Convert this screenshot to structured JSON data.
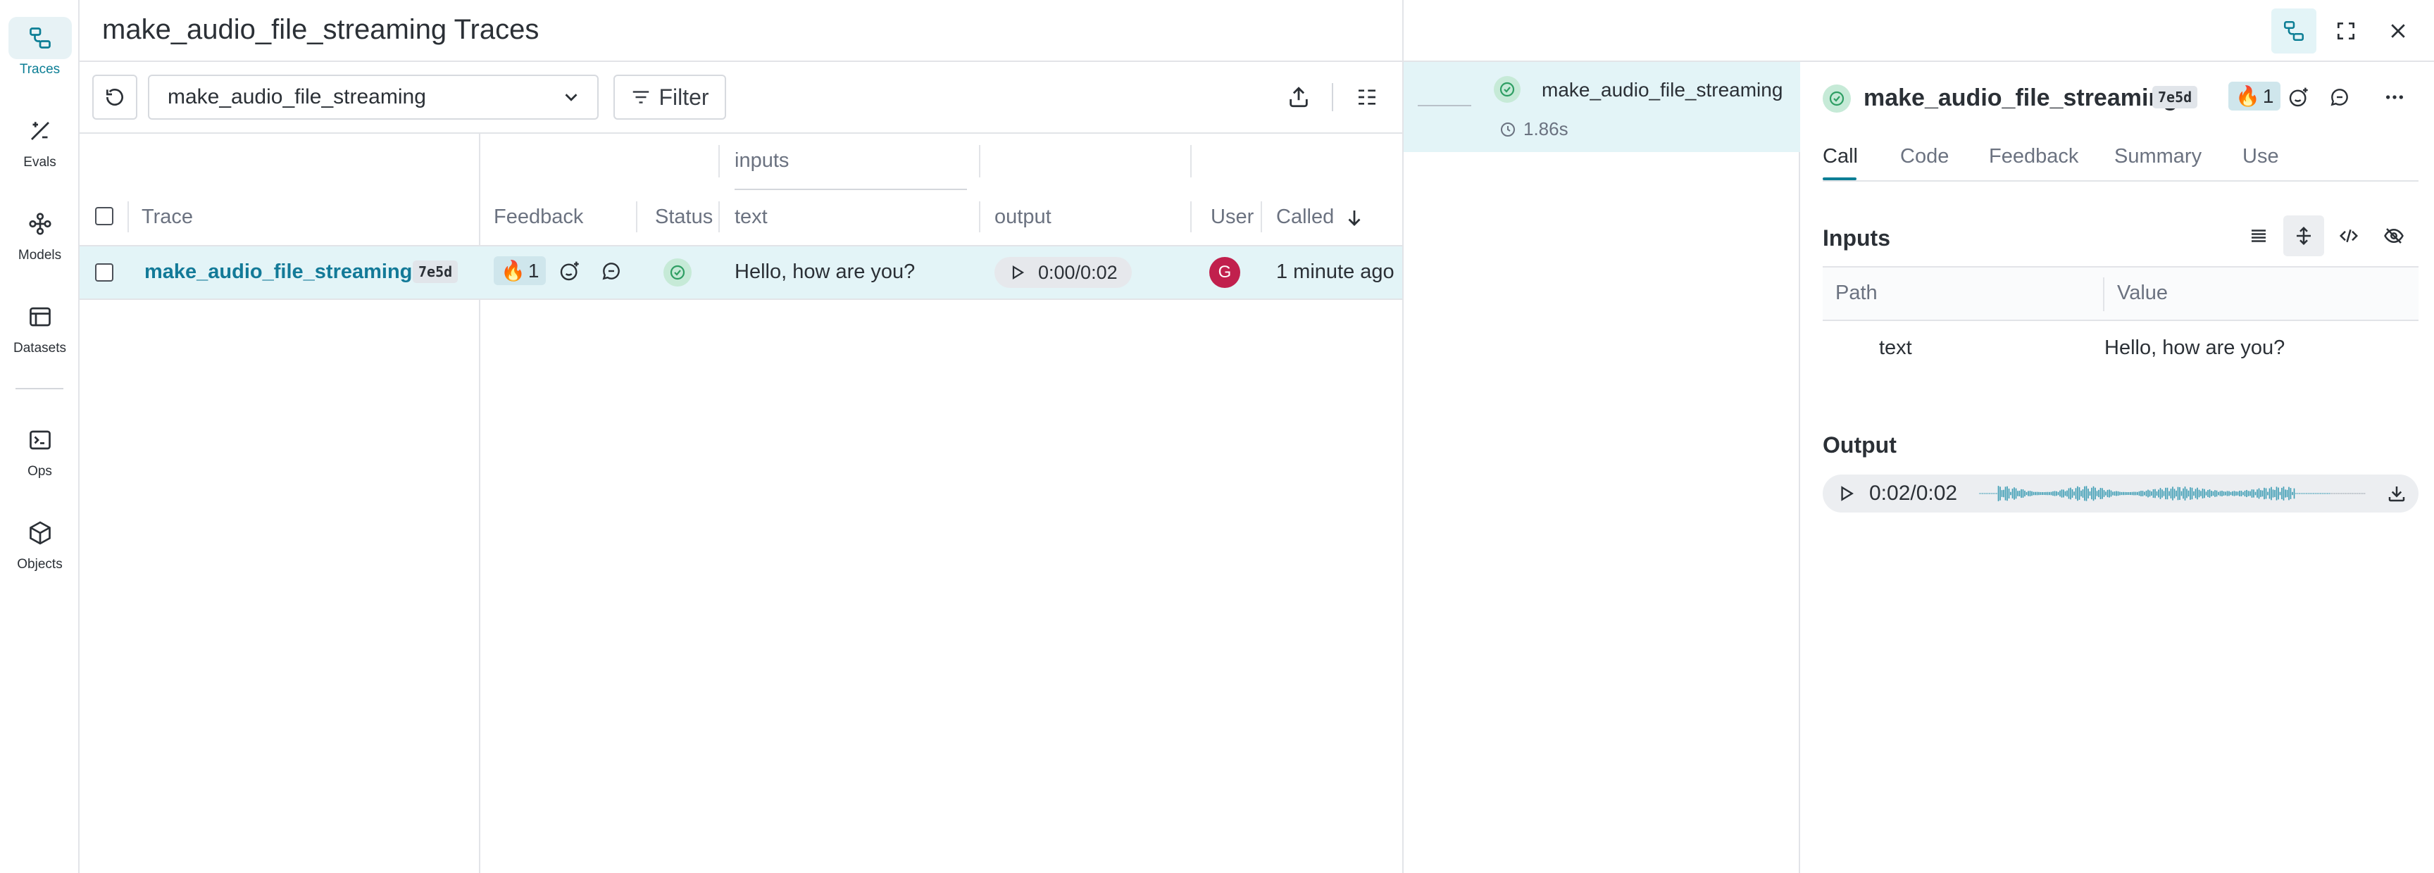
{
  "nav": {
    "items": [
      {
        "label": "Traces",
        "icon": "traces-icon",
        "active": true
      },
      {
        "label": "Evals",
        "icon": "evals-icon",
        "active": false
      },
      {
        "label": "Models",
        "icon": "models-icon",
        "active": false
      },
      {
        "label": "Datasets",
        "icon": "datasets-icon",
        "active": false
      },
      {
        "label": "Ops",
        "icon": "ops-icon",
        "active": false
      },
      {
        "label": "Objects",
        "icon": "objects-icon",
        "active": false
      }
    ]
  },
  "header": {
    "title": "make_audio_file_streaming Traces"
  },
  "toolbar": {
    "op_select_value": "make_audio_file_streaming",
    "filter_label": "Filter"
  },
  "table": {
    "group_header": "inputs",
    "headers": {
      "trace": "Trace",
      "feedback": "Feedback",
      "status": "Status",
      "text": "text",
      "output": "output",
      "user": "User",
      "called": "Called"
    },
    "rows": [
      {
        "trace": "make_audio_file_streaming",
        "trace_id": "7e5d",
        "reaction_emoji": "🔥",
        "reaction_count": "1",
        "status": "success",
        "text": "Hello, how are you?",
        "output_time": "0:00/0:02",
        "user_initial": "G",
        "called": "1 minute ago"
      }
    ]
  },
  "trace_tree": {
    "node_name": "make_audio_file_streaming",
    "duration": "1.86s"
  },
  "detail": {
    "title": "make_audio_file_streaming",
    "trace_id": "7e5d",
    "reaction_emoji": "🔥",
    "reaction_count": "1",
    "tabs": [
      "Call",
      "Code",
      "Feedback",
      "Summary",
      "Use"
    ],
    "active_tab": "Call",
    "inputs_title": "Inputs",
    "inputs_headers": {
      "path": "Path",
      "value": "Value"
    },
    "inputs_rows": [
      {
        "path": "text",
        "value": "Hello, how are you?"
      }
    ],
    "output_title": "Output",
    "output_time": "0:02/0:02"
  },
  "colors": {
    "accent": "#0c7e95",
    "selected_row": "#e3f4f7",
    "success": "#2e9e63",
    "avatar": "#c1204d"
  }
}
